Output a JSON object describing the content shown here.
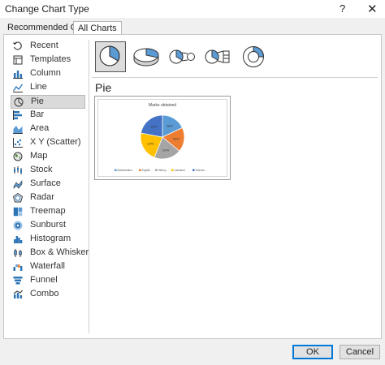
{
  "window": {
    "title": "Change Chart Type",
    "help": "?",
    "close": "✕"
  },
  "tabs": [
    {
      "label": "Recommended Charts",
      "selected": false
    },
    {
      "label": "All Charts",
      "selected": true
    }
  ],
  "sidebar": {
    "items": [
      {
        "label": "Recent",
        "icon": "recent-icon"
      },
      {
        "label": "Templates",
        "icon": "templates-icon"
      },
      {
        "label": "Column",
        "icon": "column-icon"
      },
      {
        "label": "Line",
        "icon": "line-icon"
      },
      {
        "label": "Pie",
        "icon": "pie-icon",
        "selected": true
      },
      {
        "label": "Bar",
        "icon": "bar-icon"
      },
      {
        "label": "Area",
        "icon": "area-icon"
      },
      {
        "label": "X Y (Scatter)",
        "icon": "scatter-icon"
      },
      {
        "label": "Map",
        "icon": "map-icon"
      },
      {
        "label": "Stock",
        "icon": "stock-icon"
      },
      {
        "label": "Surface",
        "icon": "surface-icon"
      },
      {
        "label": "Radar",
        "icon": "radar-icon"
      },
      {
        "label": "Treemap",
        "icon": "treemap-icon"
      },
      {
        "label": "Sunburst",
        "icon": "sunburst-icon"
      },
      {
        "label": "Histogram",
        "icon": "histogram-icon"
      },
      {
        "label": "Box & Whisker",
        "icon": "box-whisker-icon"
      },
      {
        "label": "Waterfall",
        "icon": "waterfall-icon"
      },
      {
        "label": "Funnel",
        "icon": "funnel-icon"
      },
      {
        "label": "Combo",
        "icon": "combo-icon"
      }
    ]
  },
  "subtypes": [
    {
      "icon": "pie-chart-icon",
      "selected": true
    },
    {
      "icon": "3d-pie-chart-icon"
    },
    {
      "icon": "pie-of-pie-icon"
    },
    {
      "icon": "bar-of-pie-icon"
    },
    {
      "icon": "doughnut-icon"
    }
  ],
  "section_title": "Pie",
  "chart_data": {
    "type": "pie",
    "title": "Marks obtained",
    "categories": [
      "Mathematics",
      "English",
      "History",
      "Literature",
      "Science"
    ],
    "values": [
      18,
      18,
      20,
      22,
      22
    ],
    "data_labels": [
      "18%",
      "18%",
      "20%",
      "22%",
      "22%"
    ],
    "colors": [
      "#5b9bd5",
      "#ed7d31",
      "#a5a5a5",
      "#ffc000",
      "#4472c4"
    ],
    "legend": "bottom"
  },
  "footer": {
    "ok": "OK",
    "cancel": "Cancel"
  },
  "colors": {
    "accent": "#0078d7",
    "selection": "#dadada"
  }
}
